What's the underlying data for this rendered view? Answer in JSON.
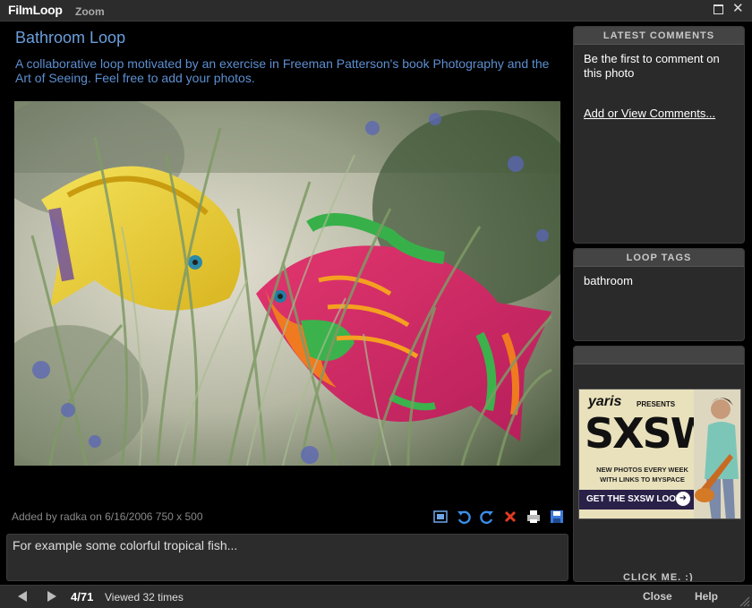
{
  "window": {
    "logo_text": "FilmLoop",
    "zoom_label": "Zoom"
  },
  "loop": {
    "title": "Bathroom Loop",
    "description": "A collaborative loop motivated by an exercise in Freeman Patterson's book Photography and the Art of Seeing. Feel free to add your photos."
  },
  "photo": {
    "meta": "Added by radka on 6/16/2006   750 x 500",
    "caption": "For example some colorful tropical fish..."
  },
  "tools": [
    "fit-to-screen-icon",
    "rotate-left-icon",
    "rotate-right-icon",
    "delete-icon",
    "print-icon",
    "save-icon"
  ],
  "comments": {
    "header": "LATEST  COMMENTS",
    "empty_text": "Be the first to comment on this photo",
    "link": "Add or View Comments..."
  },
  "tags": {
    "header": "LOOP TAGS",
    "items": [
      "bathroom"
    ]
  },
  "ad": {
    "brand": "yaris",
    "presents": "PRESENTS",
    "headline": "SXSW",
    "sub_line1": "NEW PHOTOS EVERY WEEK",
    "sub_line2": "WITH LINKS TO MYSPACE",
    "cta": "GET THE SXSW LOOP",
    "click_me": "CLICK ME. :)"
  },
  "footer": {
    "counter": "4/71",
    "viewed": "Viewed 32 times",
    "close": "Close",
    "help": "Help"
  },
  "colors": {
    "accent_blue": "#6a9fdc",
    "panel_bg": "#2a2a2a",
    "panel_header": "#444444"
  }
}
